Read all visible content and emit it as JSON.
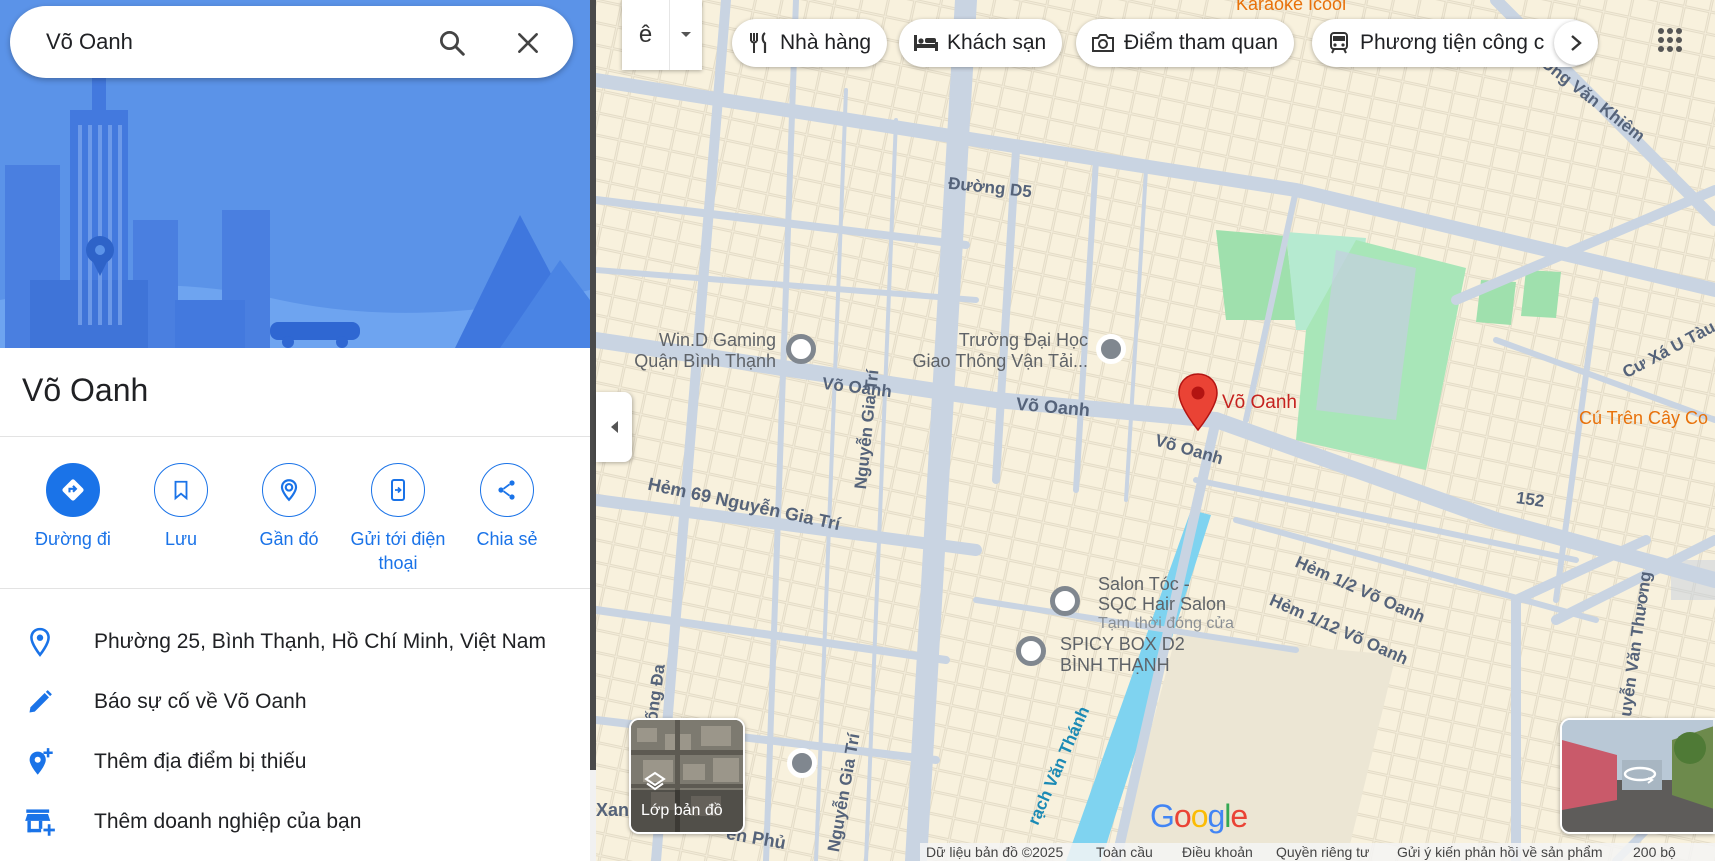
{
  "search": {
    "value": "Võ Oanh"
  },
  "place": {
    "title": "Võ Oanh"
  },
  "actions": [
    {
      "label": "Đường đi",
      "icon": "directions-icon"
    },
    {
      "label": "Lưu",
      "icon": "bookmark-icon"
    },
    {
      "label": "Gần đó",
      "icon": "nearby-icon"
    },
    {
      "label": "Gửi tới điện thoại",
      "icon": "send-to-phone-icon"
    },
    {
      "label": "Chia sẻ",
      "icon": "share-icon"
    }
  ],
  "info": [
    {
      "text": "Phường 25, Bình Thạnh, Hồ Chí Minh, Việt Nam",
      "icon": "location-pin-icon"
    },
    {
      "text": "Báo sự cố về Võ Oanh",
      "icon": "pencil-icon"
    },
    {
      "text": "Thêm địa điểm bị thiếu",
      "icon": "add-location-icon"
    },
    {
      "text": "Thêm doanh nghiệp của bạn",
      "icon": "add-business-icon"
    }
  ],
  "toolbar": {
    "ime_label": "ê"
  },
  "chips": [
    {
      "label": "Nhà hàng",
      "icon": "restaurant-icon"
    },
    {
      "label": "Khách sạn",
      "icon": "hotel-icon"
    },
    {
      "label": "Điểm tham quan",
      "icon": "camera-icon"
    },
    {
      "label": "Phương tiện công c",
      "icon": "transit-icon"
    }
  ],
  "map": {
    "streets": {
      "duong_d5": "Đường D5",
      "vo_oanh_1": "Võ Oanh",
      "vo_oanh_2": "Võ Oanh",
      "vo_oanh_3": "Võ Oanh",
      "hem69": "Hẻm 69 Nguyễn Gia Trí",
      "nguyen_gia_tri_1": "Nguyễn Gia Trí",
      "nguyen_gia_tri_2": "Nguyễn Gia Trí",
      "ung_van_khiem": "Ung Văn Khiêm",
      "cu_xa": "Cư Xá U Tàu",
      "hem_1_2": "Hẻm 1/2 Võ Oanh",
      "hem_1_12": "Hẻm 1/12 Võ Oanh",
      "rach_van_thanh": "rạch Văn Thánh",
      "nguyen_van_thuong": "uyễn Văn Thương",
      "dong_da": "ống Đa",
      "number_152": "152",
      "xan": "Xan",
      "en_phu": "ên Phủ"
    },
    "pois": {
      "win_d_1": "Win.D Gaming",
      "win_d_2": "Quận Bình Thạnh",
      "truong_1": "Trường Đại Học",
      "truong_2": "Giao Thông Vận Tải...",
      "salon_1": "Salon Tóc -",
      "salon_2": "SQC Hair Salon",
      "salon_3": "Tạm thời đóng cửa",
      "spicy_1": "SPICY BOX D2",
      "spicy_2": "BÌNH THẠNH",
      "karaoke": "Karaoke Icool",
      "cu_tren": "Cú Trên Cây Co",
      "pin_label": "Võ Oanh"
    },
    "layers_label": "Lớp bản đồ",
    "footer": {
      "data": "Dữ liệu bản đồ ©2025",
      "global": "Toàn cầu",
      "terms": "Điều khoản",
      "privacy": "Quyền riêng tư",
      "feedback": "Gửi ý kiến phản hồi về sản phẩm",
      "scale": "200 bộ"
    },
    "colors": {
      "pin": "#ea4335",
      "accent": "#1a73e8",
      "road": "#c9d4e2",
      "park": "#a8e6b8",
      "water": "#7fd3f0"
    }
  }
}
